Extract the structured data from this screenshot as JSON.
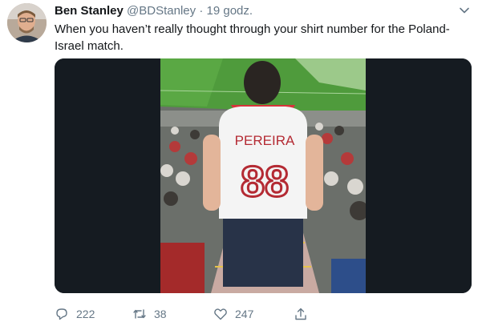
{
  "tweet": {
    "author_name": "Ben Stanley",
    "handle": "@BDStanley",
    "separator": "·",
    "time": "19 godz.",
    "text": "When you haven’t really thought through your shirt number for the Poland-Israel match.",
    "photo": {
      "shirt_name": "PEREIRA",
      "shirt_number": "88"
    },
    "actions": {
      "replies": "222",
      "retweets": "38",
      "likes": "247"
    },
    "icons": [
      "chevron-down-icon",
      "reply-icon",
      "retweet-icon",
      "like-icon",
      "share-icon"
    ]
  }
}
